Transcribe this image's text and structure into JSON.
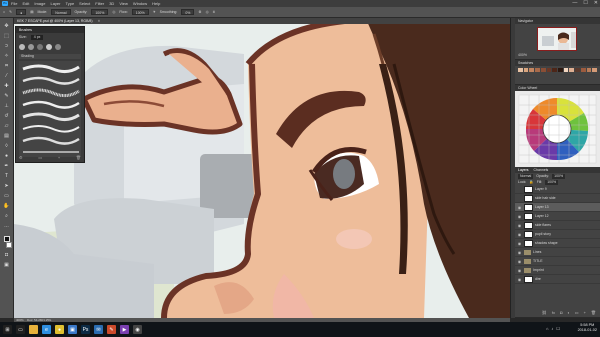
{
  "app": {
    "logo": "Ps",
    "menus": [
      "File",
      "Edit",
      "Image",
      "Layer",
      "Type",
      "Select",
      "Filter",
      "3D",
      "View",
      "Window",
      "Help"
    ],
    "window_controls": [
      "—",
      "☐",
      "✕"
    ]
  },
  "options_bar": {
    "mode_label": "Mode:",
    "mode_value": "Normal",
    "opacity_label": "Opacity:",
    "opacity_value": "100%",
    "flow_label": "Flow:",
    "flow_value": "100%",
    "smoothing_label": "Smoothing:",
    "smoothing_value": "0%"
  },
  "document_tab": {
    "title": "KEK 7 ESCAPE.psd @ 400% (Layer 13, RGB/8)",
    "close": "✕"
  },
  "brushes_panel": {
    "title": "Brushes",
    "size_label": "Size:",
    "size_value": "4 px",
    "folder_label": "Shading",
    "footer_icons": [
      "brush-settings-icon",
      "folder-icon",
      "new-icon",
      "trash-icon"
    ]
  },
  "navigator": {
    "title": "Navigator",
    "zoom": "400%"
  },
  "swatches": {
    "title": "Swatches",
    "colors": [
      "#e8c2a4",
      "#d8a57f",
      "#c38560",
      "#a86a4a",
      "#8a4e35",
      "#6b3826",
      "#4d2618",
      "#2c1810",
      "#f1d5c0",
      "#e0b093",
      "#5a3a2e",
      "#9c5b3e",
      "#b97c58",
      "#d59b77"
    ]
  },
  "color_wheel": {
    "title": "Color Wheel"
  },
  "layers": {
    "tabs": [
      "Layers",
      "Channels"
    ],
    "blend_mode": "Normal",
    "opacity_label": "Opacity:",
    "opacity_value": "100%",
    "lock_label": "Lock:",
    "fill_label": "Fill:",
    "fill_value": "100%",
    "rows": [
      {
        "name": "Layer 9",
        "visible": false,
        "selected": false,
        "folder": false
      },
      {
        "name": "side hair side",
        "visible": false,
        "selected": false,
        "folder": false
      },
      {
        "name": "Layer 13",
        "visible": true,
        "selected": true,
        "folder": false
      },
      {
        "name": "Layer 12",
        "visible": true,
        "selected": false,
        "folder": false
      },
      {
        "name": "side flares",
        "visible": true,
        "selected": false,
        "folder": false
      },
      {
        "name": "pupil story",
        "visible": true,
        "selected": false,
        "folder": false
      },
      {
        "name": "shadow shape",
        "visible": true,
        "selected": false,
        "folder": false
      },
      {
        "name": "Lines",
        "visible": true,
        "selected": false,
        "folder": true
      },
      {
        "name": "TITLE",
        "visible": true,
        "selected": false,
        "folder": true
      },
      {
        "name": "Imprint",
        "visible": true,
        "selected": false,
        "folder": true
      },
      {
        "name": "dire",
        "visible": true,
        "selected": false,
        "folder": false
      }
    ]
  },
  "status_bar": {
    "zoom": "400%",
    "doc_info": "Doc: 54.2M/1.25G"
  },
  "taskbar": {
    "apps": [
      {
        "icon": "windows-icon",
        "color": "#1f1f1f",
        "glyph": "⊞"
      },
      {
        "icon": "task-view-icon",
        "color": "#1f1f1f",
        "glyph": "▭"
      },
      {
        "icon": "folder-icon",
        "color": "#e8b23b",
        "glyph": ""
      },
      {
        "icon": "edge-icon",
        "color": "#2f8fe0",
        "glyph": "e"
      },
      {
        "icon": "chrome-icon",
        "color": "#e0c030",
        "glyph": "●"
      },
      {
        "icon": "store-icon",
        "color": "#3a78c8",
        "glyph": "▣"
      },
      {
        "icon": "photoshop-icon",
        "color": "#0c2a44",
        "glyph": "Ps"
      },
      {
        "icon": "mail-icon",
        "color": "#2b6cb0",
        "glyph": "✉"
      },
      {
        "icon": "paint-icon",
        "color": "#cc4a2b",
        "glyph": "✎"
      },
      {
        "icon": "media-icon",
        "color": "#7a3fb0",
        "glyph": "▶"
      },
      {
        "icon": "camera-icon",
        "color": "#444",
        "glyph": "◉"
      }
    ],
    "time": "5:58 PM",
    "date": "2018-01-02"
  }
}
